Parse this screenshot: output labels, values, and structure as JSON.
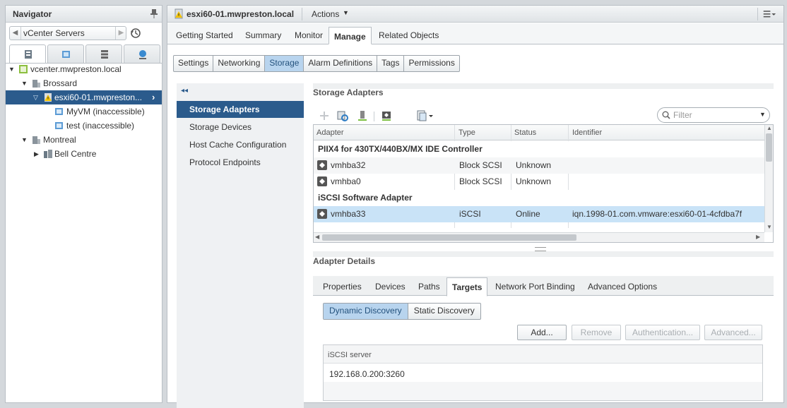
{
  "navigator": {
    "title": "Navigator",
    "breadcrumb": "vCenter Servers",
    "tabs": [
      "hosts-clusters",
      "vms-templates",
      "storage",
      "networking"
    ],
    "tree": [
      {
        "label": "vcenter.mwpreston.local",
        "icon": "vcenter-icon"
      },
      {
        "label": "Brossard",
        "icon": "datacenter-icon"
      },
      {
        "label": "esxi60-01.mwpreston...",
        "icon": "host-warning-icon",
        "selected": true
      },
      {
        "label": "MyVM (inaccessible)",
        "icon": "vm-icon"
      },
      {
        "label": "test (inaccessible)",
        "icon": "vm-icon"
      },
      {
        "label": "Montreal",
        "icon": "datacenter-icon"
      },
      {
        "label": "Bell Centre",
        "icon": "cluster-icon"
      }
    ]
  },
  "header": {
    "host": "esxi60-01.mwpreston.local",
    "actions": "Actions"
  },
  "main_tabs": [
    "Getting Started",
    "Summary",
    "Monitor",
    "Manage",
    "Related Objects"
  ],
  "active_main_tab": "Manage",
  "sub_tabs": [
    "Settings",
    "Networking",
    "Storage",
    "Alarm Definitions",
    "Tags",
    "Permissions"
  ],
  "active_sub_tab": "Storage",
  "storage_nav": [
    "Storage Adapters",
    "Storage Devices",
    "Host Cache Configuration",
    "Protocol Endpoints"
  ],
  "storage_adapters": {
    "title": "Storage Adapters",
    "filter_placeholder": "Filter",
    "columns": [
      "Adapter",
      "Type",
      "Status",
      "Identifier"
    ],
    "groups": [
      {
        "name": "PIIX4 for 430TX/440BX/MX IDE Controller",
        "rows": [
          {
            "adapter": "vmhba32",
            "type": "Block SCSI",
            "status": "Unknown",
            "identifier": ""
          },
          {
            "adapter": "vmhba0",
            "type": "Block SCSI",
            "status": "Unknown",
            "identifier": ""
          }
        ]
      },
      {
        "name": "iSCSI Software Adapter",
        "rows": [
          {
            "adapter": "vmhba33",
            "type": "iSCSI",
            "status": "Online",
            "identifier": "iqn.1998-01.com.vmware:esxi60-01-4cfdba7f"
          }
        ]
      }
    ]
  },
  "adapter_details": {
    "title": "Adapter Details",
    "tabs": [
      "Properties",
      "Devices",
      "Paths",
      "Targets",
      "Network Port Binding",
      "Advanced Options"
    ],
    "active_tab": "Targets",
    "discovery": [
      "Dynamic Discovery",
      "Static Discovery"
    ],
    "active_discovery": "Dynamic Discovery",
    "buttons": {
      "add": "Add...",
      "remove": "Remove",
      "authentication": "Authentication...",
      "advanced": "Advanced..."
    },
    "server_column": "iSCSI server",
    "servers": [
      "192.168.0.200:3260"
    ]
  }
}
